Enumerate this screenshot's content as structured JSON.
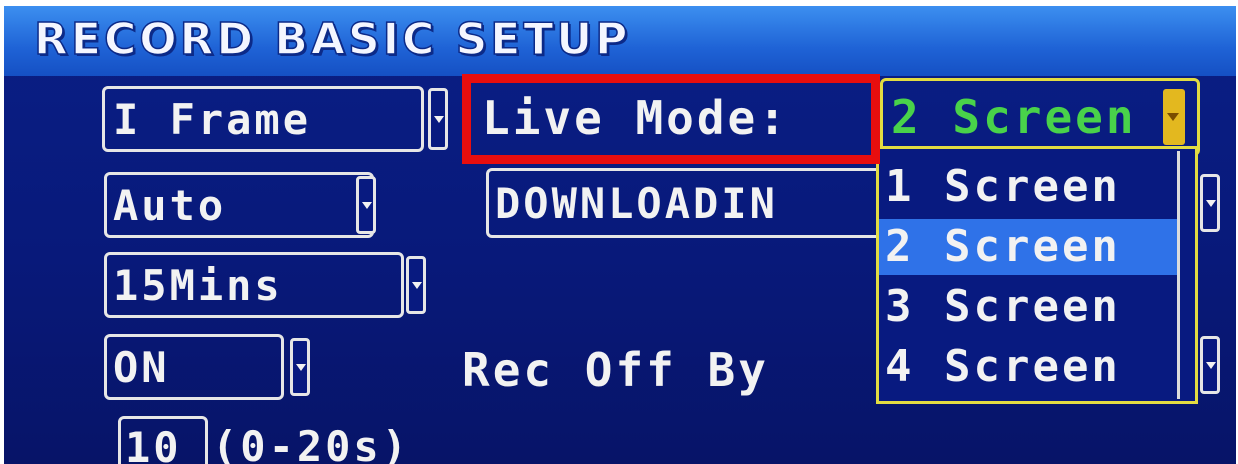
{
  "window": {
    "title": "RECORD BASIC SETUP"
  },
  "fields": {
    "frame_select": "I Frame",
    "auto_select": "Auto",
    "duration_select": "15Mins",
    "on_select": "ON",
    "seconds_value": "10",
    "seconds_range": "(0-20s)"
  },
  "labels": {
    "live_mode": "Live Mode:",
    "downloading": "DOWNLOADIN",
    "rec_off_by": "Rec Off By"
  },
  "live_mode_select": {
    "current_value": "2 Screen",
    "options": [
      "1 Screen",
      "2 Screen",
      "3 Screen",
      "4 Screen"
    ],
    "selected": "2 Screen"
  },
  "colors": {
    "background": "#08197a",
    "title_bar": "#1f63d6",
    "highlight": "#2f72e8",
    "selected_value": "#49d24a",
    "focus_border": "#e3dc42",
    "annotation": "#e80e0e"
  },
  "icons": {
    "dropdown_arrow": "chevron-down-icon"
  }
}
